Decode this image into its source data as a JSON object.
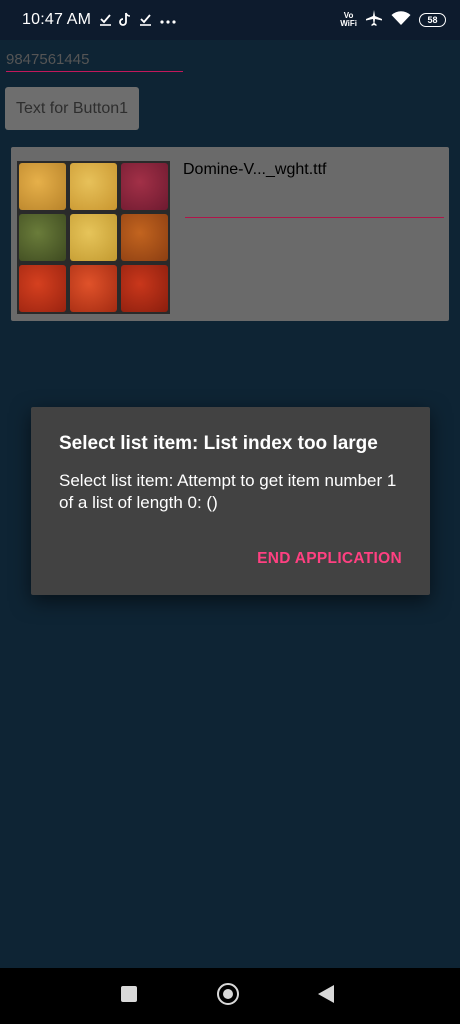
{
  "status_bar": {
    "time": "10:47 AM",
    "left_icons": [
      "download-check-icon",
      "tiktok-icon",
      "download-check-icon",
      "more-icon"
    ],
    "right_icons": [
      "vowifi-icon",
      "airplane-icon",
      "wifi-icon",
      "battery-icon"
    ],
    "vowifi_top": "Vo",
    "vowifi_bottom": "WiFi",
    "battery": "58"
  },
  "app": {
    "phone_input_value": "9847561445",
    "button1_label": "Text for Button1",
    "card": {
      "image": "spices-photo",
      "filename": "Domine-V..._wght.ttf"
    }
  },
  "dialog": {
    "title": "Select list item: List index too large",
    "message": "Select list item: Attempt to get item number 1 of a list of length 0: ()",
    "button_label": "END APPLICATION",
    "accent_color": "#ff4081"
  },
  "nav_bar": {
    "buttons": [
      "recents-icon",
      "home-icon",
      "back-icon"
    ]
  }
}
